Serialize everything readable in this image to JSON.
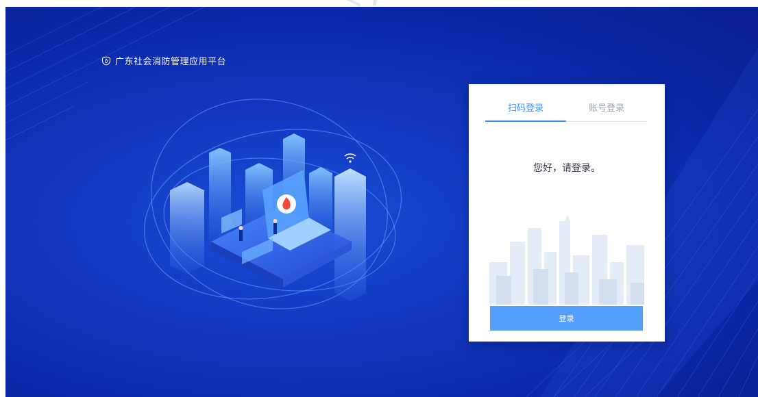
{
  "brand": {
    "title": "广东社会消防管理应用平台",
    "icon": "shield-icon"
  },
  "login": {
    "tabs": [
      {
        "label": "扫码登录",
        "active": true
      },
      {
        "label": "账号登录",
        "active": false
      }
    ],
    "greeting": "您好，请登录。",
    "button_label": "登录"
  },
  "colors": {
    "accent": "#3f8ff5",
    "button": "#54a0fb",
    "background": "#1238c2"
  }
}
